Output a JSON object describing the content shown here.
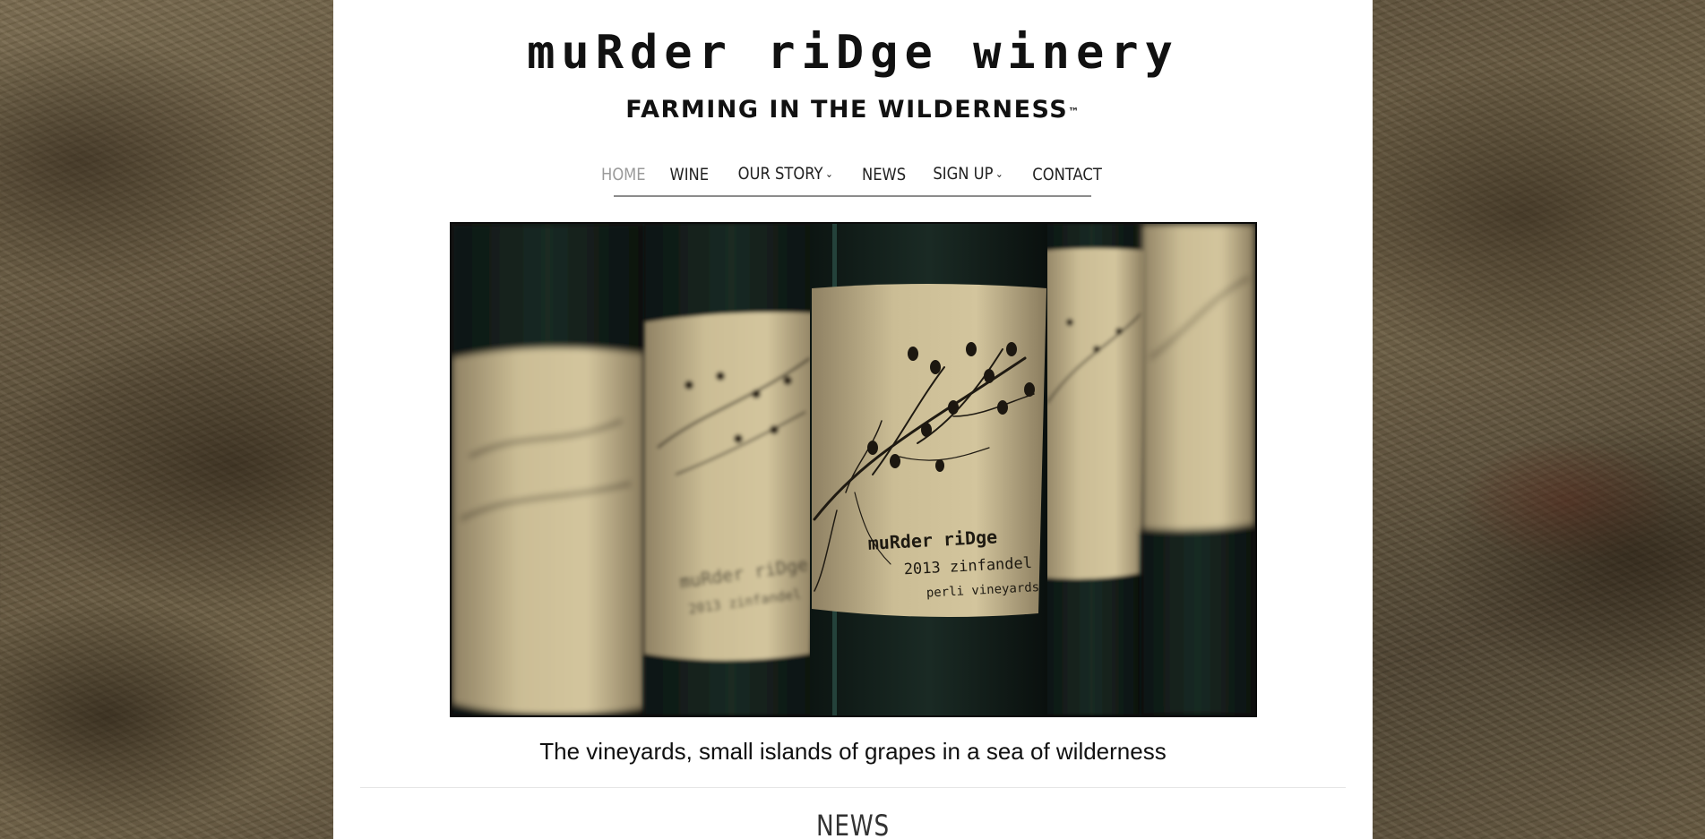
{
  "site": {
    "logo_text": "muRder riDge winery",
    "tagline": "FARMING IN THE WILDERNESS",
    "tagline_mark": "™"
  },
  "nav": {
    "items": [
      {
        "label": "HOME",
        "active": true,
        "has_dropdown": false
      },
      {
        "label": "WINE",
        "active": false,
        "has_dropdown": false
      },
      {
        "label": "OUR STORY",
        "active": false,
        "has_dropdown": true
      },
      {
        "label": "NEWS",
        "active": false,
        "has_dropdown": false
      },
      {
        "label": "SIGN UP",
        "active": false,
        "has_dropdown": true
      },
      {
        "label": "CONTACT",
        "active": false,
        "has_dropdown": false
      }
    ],
    "dropdown_icon": "chevron-down-icon"
  },
  "hero": {
    "label_line1": "muRder riDge",
    "label_line2": "2013 zinfandel",
    "label_line3": "perli vineyards",
    "caption": "The vineyards, small islands of grapes in a sea of wilderness"
  },
  "news": {
    "heading": "NEWS"
  },
  "colors": {
    "page_background": "#6b5d44",
    "content_background": "#ffffff",
    "nav_active": "#9a9a9a",
    "nav_text": "#222222",
    "label_paper": "#c9b98f"
  }
}
